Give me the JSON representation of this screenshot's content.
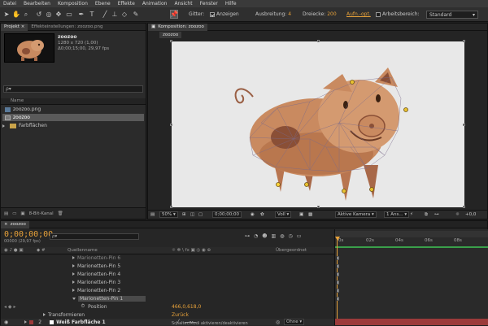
{
  "menu": [
    "Datei",
    "Bearbeiten",
    "Komposition",
    "Ebene",
    "Effekte",
    "Animation",
    "Ansicht",
    "Fenster",
    "Hilfe"
  ],
  "toolbar": {
    "gitter_label": "Gitter:",
    "anzeigen_label": "Anzeigen",
    "ausbreitung_label": "Ausbreitung:",
    "ausbreitung_value": "4",
    "dreiecke_label": "Dreiecke:",
    "dreiecke_value": "200",
    "aufn_opt": "Aufn.-opt.",
    "arbeitsbereich_label": "Arbeitsbereich:",
    "arbeitsbereich_value": "Standard"
  },
  "project": {
    "tabs": [
      "Projekt ×",
      "Effekteinstellungen: zoozoo.png"
    ],
    "item_name": "zoozoo",
    "item_info1": "1280 x 720 (1,00)",
    "item_info2": "Δ0;00;15;00, 29,97 fps",
    "search_placeholder": "ρ▾",
    "column_name": "Name",
    "items": [
      "zoozoo.png",
      "zoozoo",
      "Farbflächen"
    ],
    "bpc": "8-Bit-Kanal"
  },
  "composition": {
    "tab": "Komposition: zoozoo",
    "subtab": "zoozoo",
    "zoom": "50%",
    "timecode": "0;00;00;00",
    "quality": "Voll",
    "camera": "Aktive Kamera",
    "views": "1 Ans...",
    "exposure": "+0,0"
  },
  "timeline": {
    "tab": "zoozoo",
    "timecode": "0;00;00;00",
    "frame_info": "00000 (29,97 fps)",
    "search_placeholder": "ρ▾",
    "col_source": "Quellenname",
    "col_parent": "Übergeordnet",
    "ruler": [
      "0s",
      "02s",
      "04s",
      "06s",
      "08s"
    ],
    "layers": [
      "Marionetten-Pin 6",
      "Marionetten-Pin 5",
      "Marionetten-Pin 4",
      "Marionetten-Pin 3",
      "Marionetten-Pin 2",
      "Marionetten-Pin 1"
    ],
    "position_label": "Position",
    "position_value": "466,0,618,0",
    "transform_label": "Transformieren",
    "reset_label": "Zurück",
    "layer2_num": "2",
    "layer2_name": "Weiß Farbfläche 1",
    "parent_value": "Ohne",
    "footer": "Schalter/Modi aktivieren/deaktivieren"
  },
  "colors": {
    "accent_orange": "#e8a23a",
    "pig_main": "#c98a60",
    "pig_dark": "#8a4f36",
    "work_area_green": "#3aa04a",
    "layer_red": "#9c3a3a"
  }
}
